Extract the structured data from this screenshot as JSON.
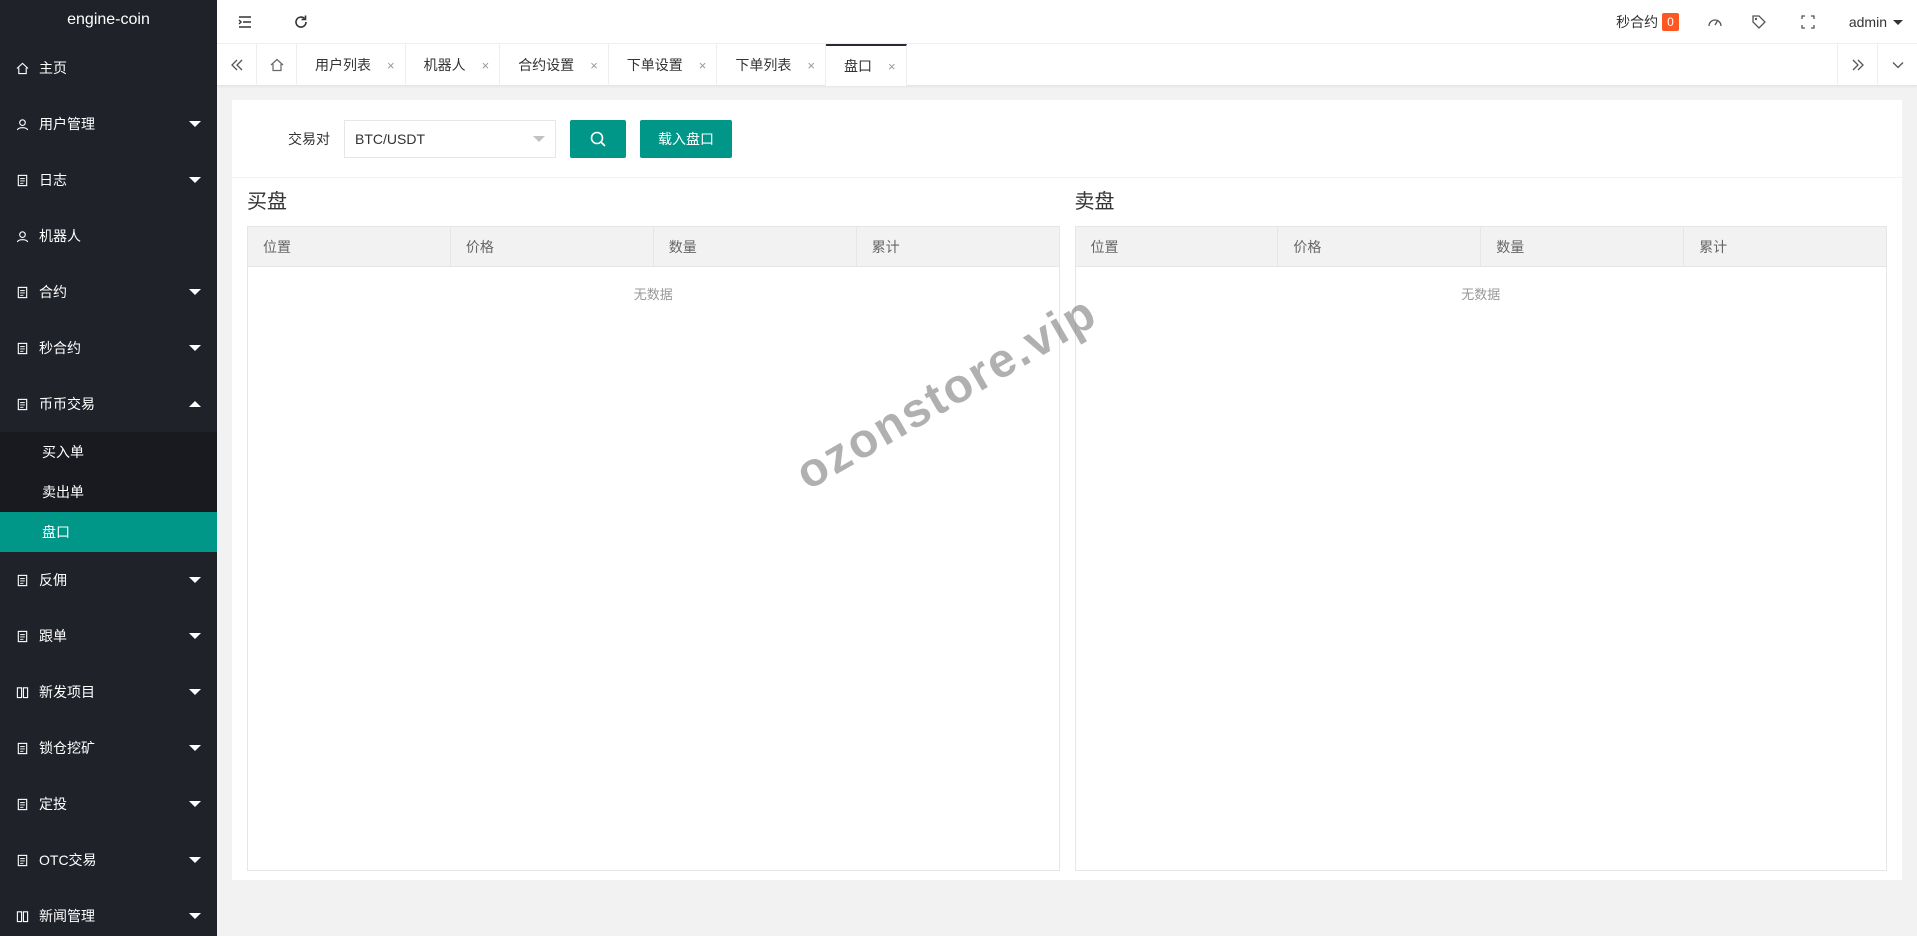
{
  "app": {
    "title": "engine-coin"
  },
  "sidebar": {
    "items": [
      {
        "label": "主页"
      },
      {
        "label": "用户管理"
      },
      {
        "label": "日志"
      },
      {
        "label": "机器人"
      },
      {
        "label": "合约"
      },
      {
        "label": "秒合约"
      },
      {
        "label": "币币交易"
      },
      {
        "label": "反佣"
      },
      {
        "label": "跟单"
      },
      {
        "label": "新发项目"
      },
      {
        "label": "锁仓挖矿"
      },
      {
        "label": "定投"
      },
      {
        "label": "OTC交易"
      },
      {
        "label": "新闻管理"
      }
    ],
    "submenu": [
      {
        "label": "买入单"
      },
      {
        "label": "卖出单"
      },
      {
        "label": "盘口"
      }
    ]
  },
  "header": {
    "seconds_contract_label": "秒合约",
    "seconds_contract_count": "0",
    "user": "admin"
  },
  "tabs": [
    {
      "label": "用户列表"
    },
    {
      "label": "机器人"
    },
    {
      "label": "合约设置"
    },
    {
      "label": "下单设置"
    },
    {
      "label": "下单列表"
    },
    {
      "label": "盘口"
    }
  ],
  "tab_close_glyph": "×",
  "filter": {
    "label": "交易对",
    "pair_value": "BTC/USDT",
    "load_button": "载入盘口"
  },
  "buy_panel": {
    "title": "买盘",
    "columns": [
      "位置",
      "价格",
      "数量",
      "累计"
    ],
    "empty_text": "无数据"
  },
  "sell_panel": {
    "title": "卖盘",
    "columns": [
      "位置",
      "价格",
      "数量",
      "累计"
    ],
    "empty_text": "无数据"
  },
  "watermark": "ozonstore.vip",
  "colors": {
    "accent": "#009688",
    "sidebar": "#20222a",
    "badge": "#ff5722"
  }
}
